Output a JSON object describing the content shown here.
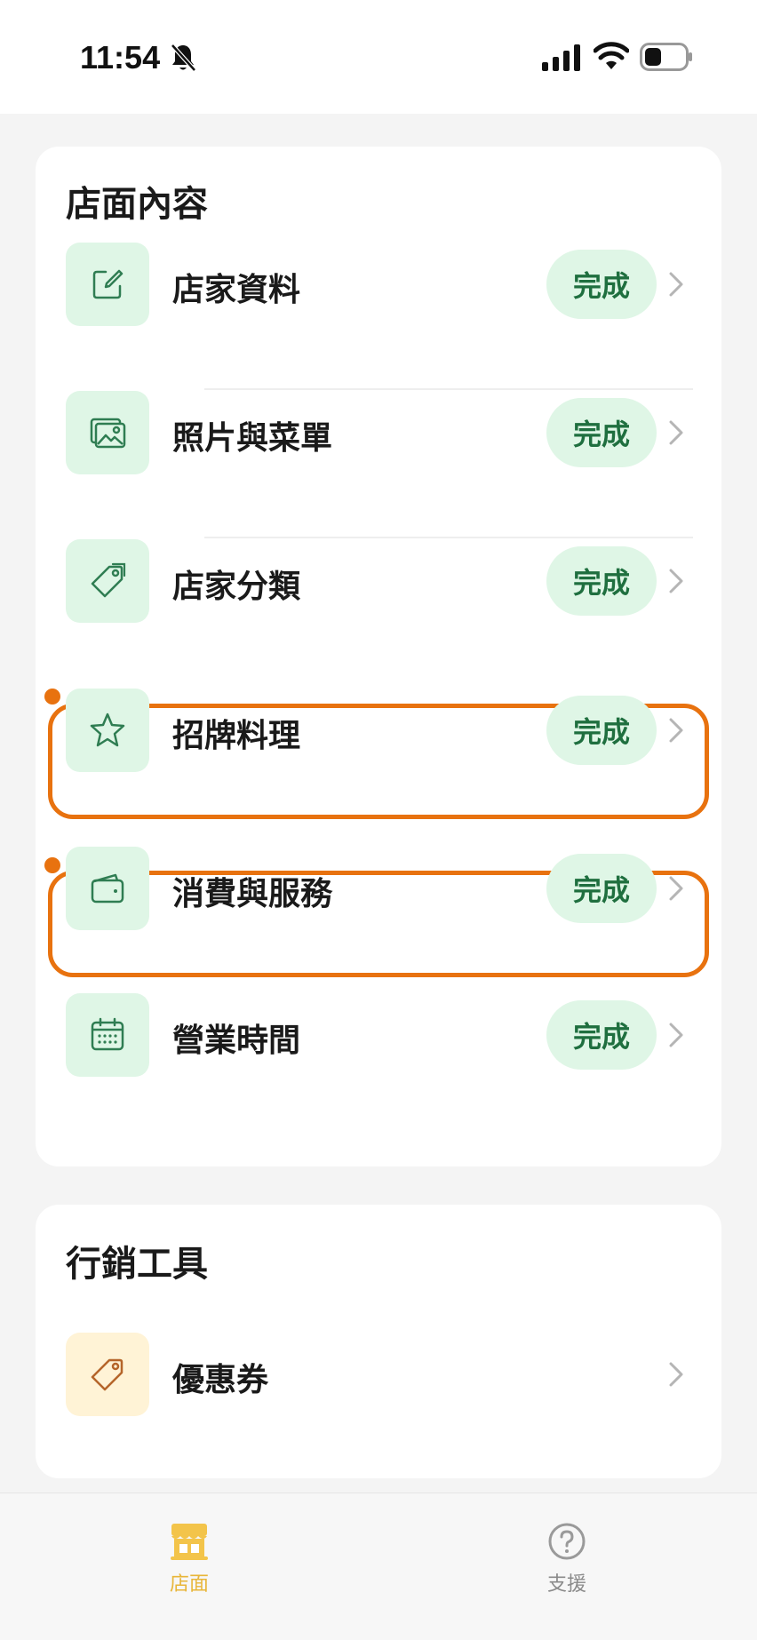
{
  "status_bar": {
    "time": "11:54",
    "icons": [
      "bell-off-icon",
      "signal-icon",
      "wifi-icon",
      "battery-icon"
    ]
  },
  "store_content": {
    "title": "店面內容",
    "items": [
      {
        "label": "店家資料",
        "status": "完成",
        "icon": "edit-icon"
      },
      {
        "label": "照片與菜單",
        "status": "完成",
        "icon": "photo-icon"
      },
      {
        "label": "店家分類",
        "status": "完成",
        "icon": "tag-icon"
      },
      {
        "label": "招牌料理",
        "status": "完成",
        "icon": "star-icon"
      },
      {
        "label": "消費與服務",
        "status": "完成",
        "icon": "wallet-icon"
      },
      {
        "label": "營業時間",
        "status": "完成",
        "icon": "calendar-icon"
      }
    ]
  },
  "marketing_tools": {
    "title": "行銷工具",
    "items": [
      {
        "label": "優惠券",
        "icon": "coupon-tag-icon"
      }
    ]
  },
  "tab_bar": {
    "tabs": [
      {
        "label": "店面",
        "icon": "store-icon",
        "active": true
      },
      {
        "label": "支援",
        "icon": "help-icon",
        "active": false
      }
    ]
  },
  "colors": {
    "accent_green": "#1f6f3f",
    "badge_bg": "#dff6e6",
    "highlight_orange": "#e8720f",
    "active_tab": "#e8b63a"
  }
}
